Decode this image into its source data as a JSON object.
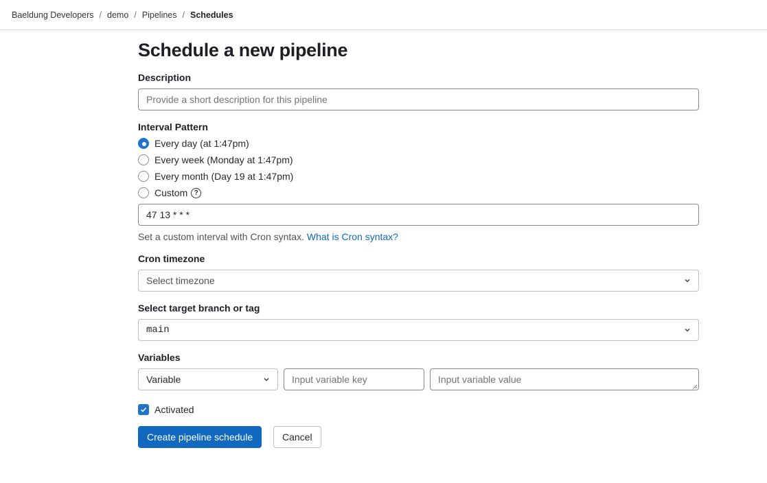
{
  "breadcrumb": {
    "items": [
      "Baeldung Developers",
      "demo",
      "Pipelines",
      "Schedules"
    ]
  },
  "page": {
    "title": "Schedule a new pipeline"
  },
  "form": {
    "description": {
      "label": "Description",
      "placeholder": "Provide a short description for this pipeline",
      "value": ""
    },
    "interval": {
      "label": "Interval Pattern",
      "options": [
        {
          "label": "Every day (at 1:47pm)",
          "checked": true
        },
        {
          "label": "Every week (Monday at 1:47pm)",
          "checked": false
        },
        {
          "label": "Every month (Day 19 at 1:47pm)",
          "checked": false
        },
        {
          "label": "Custom",
          "checked": false
        }
      ],
      "cron_value": "47 13 * * *",
      "help_text": "Set a custom interval with Cron syntax.",
      "help_link": "What is Cron syntax?"
    },
    "timezone": {
      "label": "Cron timezone",
      "placeholder": "Select timezone"
    },
    "branch": {
      "label": "Select target branch or tag",
      "value": "main"
    },
    "variables": {
      "label": "Variables",
      "type_value": "Variable",
      "key_placeholder": "Input variable key",
      "value_placeholder": "Input variable value"
    },
    "activated": {
      "label": "Activated",
      "checked": true
    },
    "buttons": {
      "create": "Create pipeline schedule",
      "cancel": "Cancel"
    }
  },
  "colors": {
    "primary": "#1068bf",
    "checked": "#1f75cb",
    "link": "#1068bf"
  }
}
